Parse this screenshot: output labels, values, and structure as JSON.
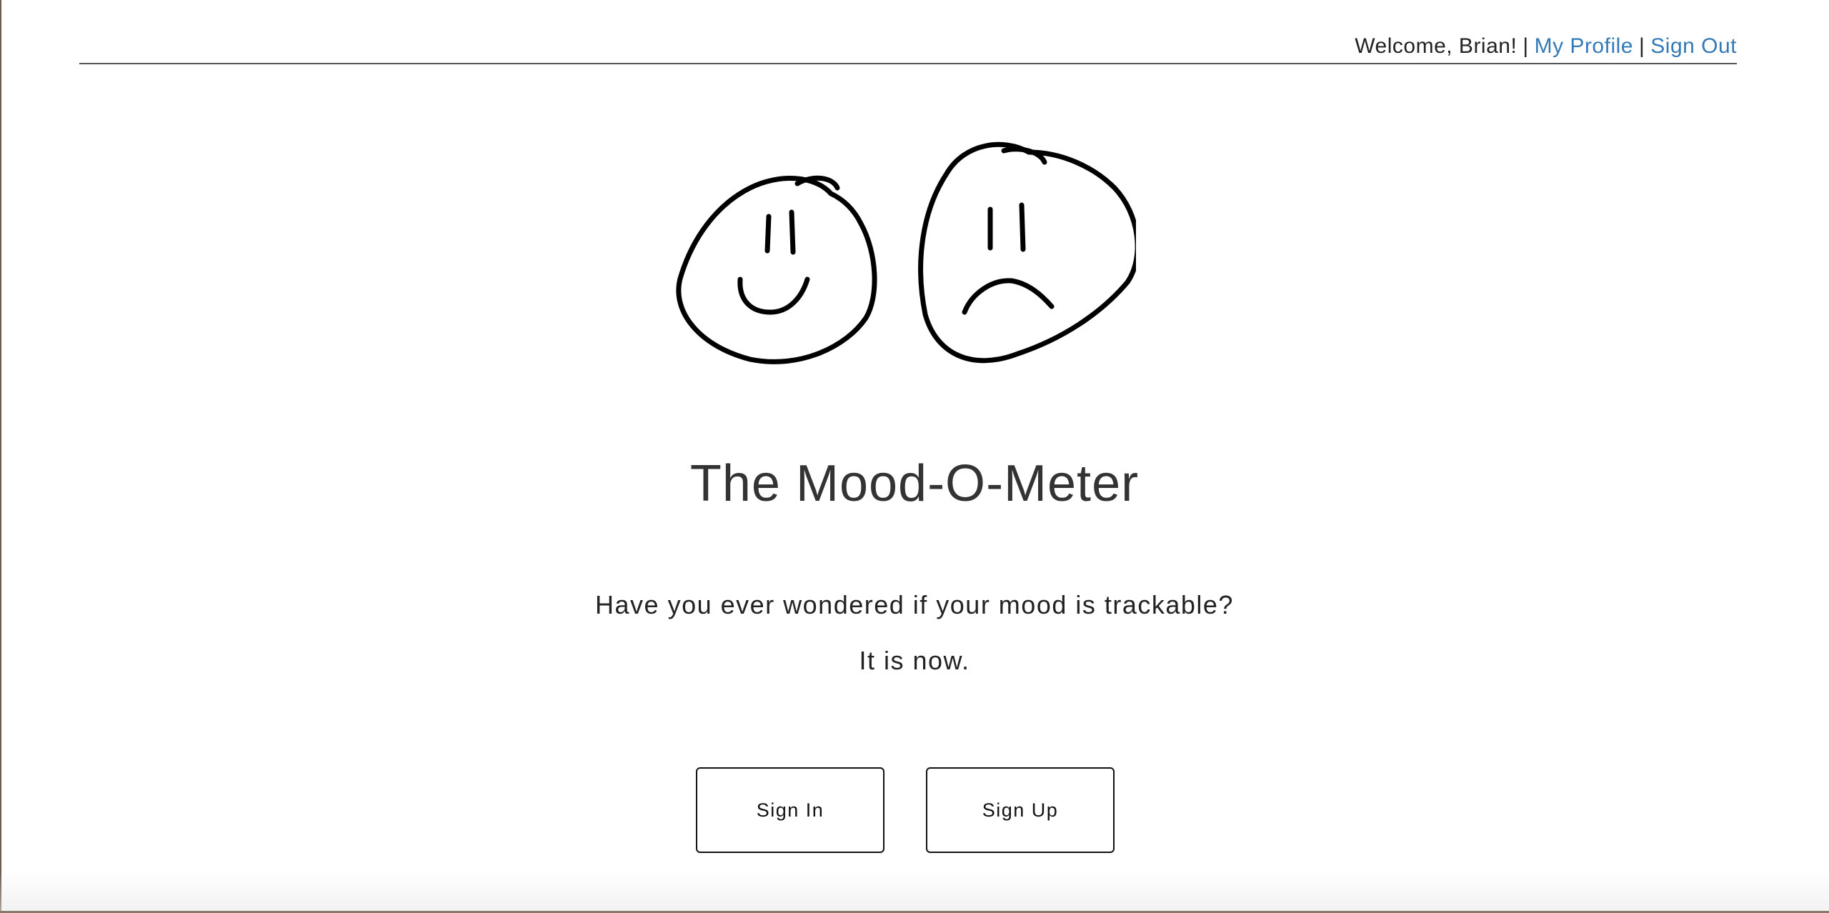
{
  "header": {
    "welcome_text": "Welcome, Brian!",
    "separator": "|",
    "my_profile_label": "My Profile",
    "sign_out_label": "Sign Out",
    "link_color": "#337ab7"
  },
  "hero": {
    "logo_icons": [
      "happy-face-icon",
      "sad-face-icon"
    ],
    "title": "The Mood-O-Meter",
    "tagline_line1": "Have you ever wondered if your mood is trackable?",
    "tagline_line2": "It is now."
  },
  "actions": {
    "sign_in_label": "Sign In",
    "sign_up_label": "Sign Up"
  }
}
